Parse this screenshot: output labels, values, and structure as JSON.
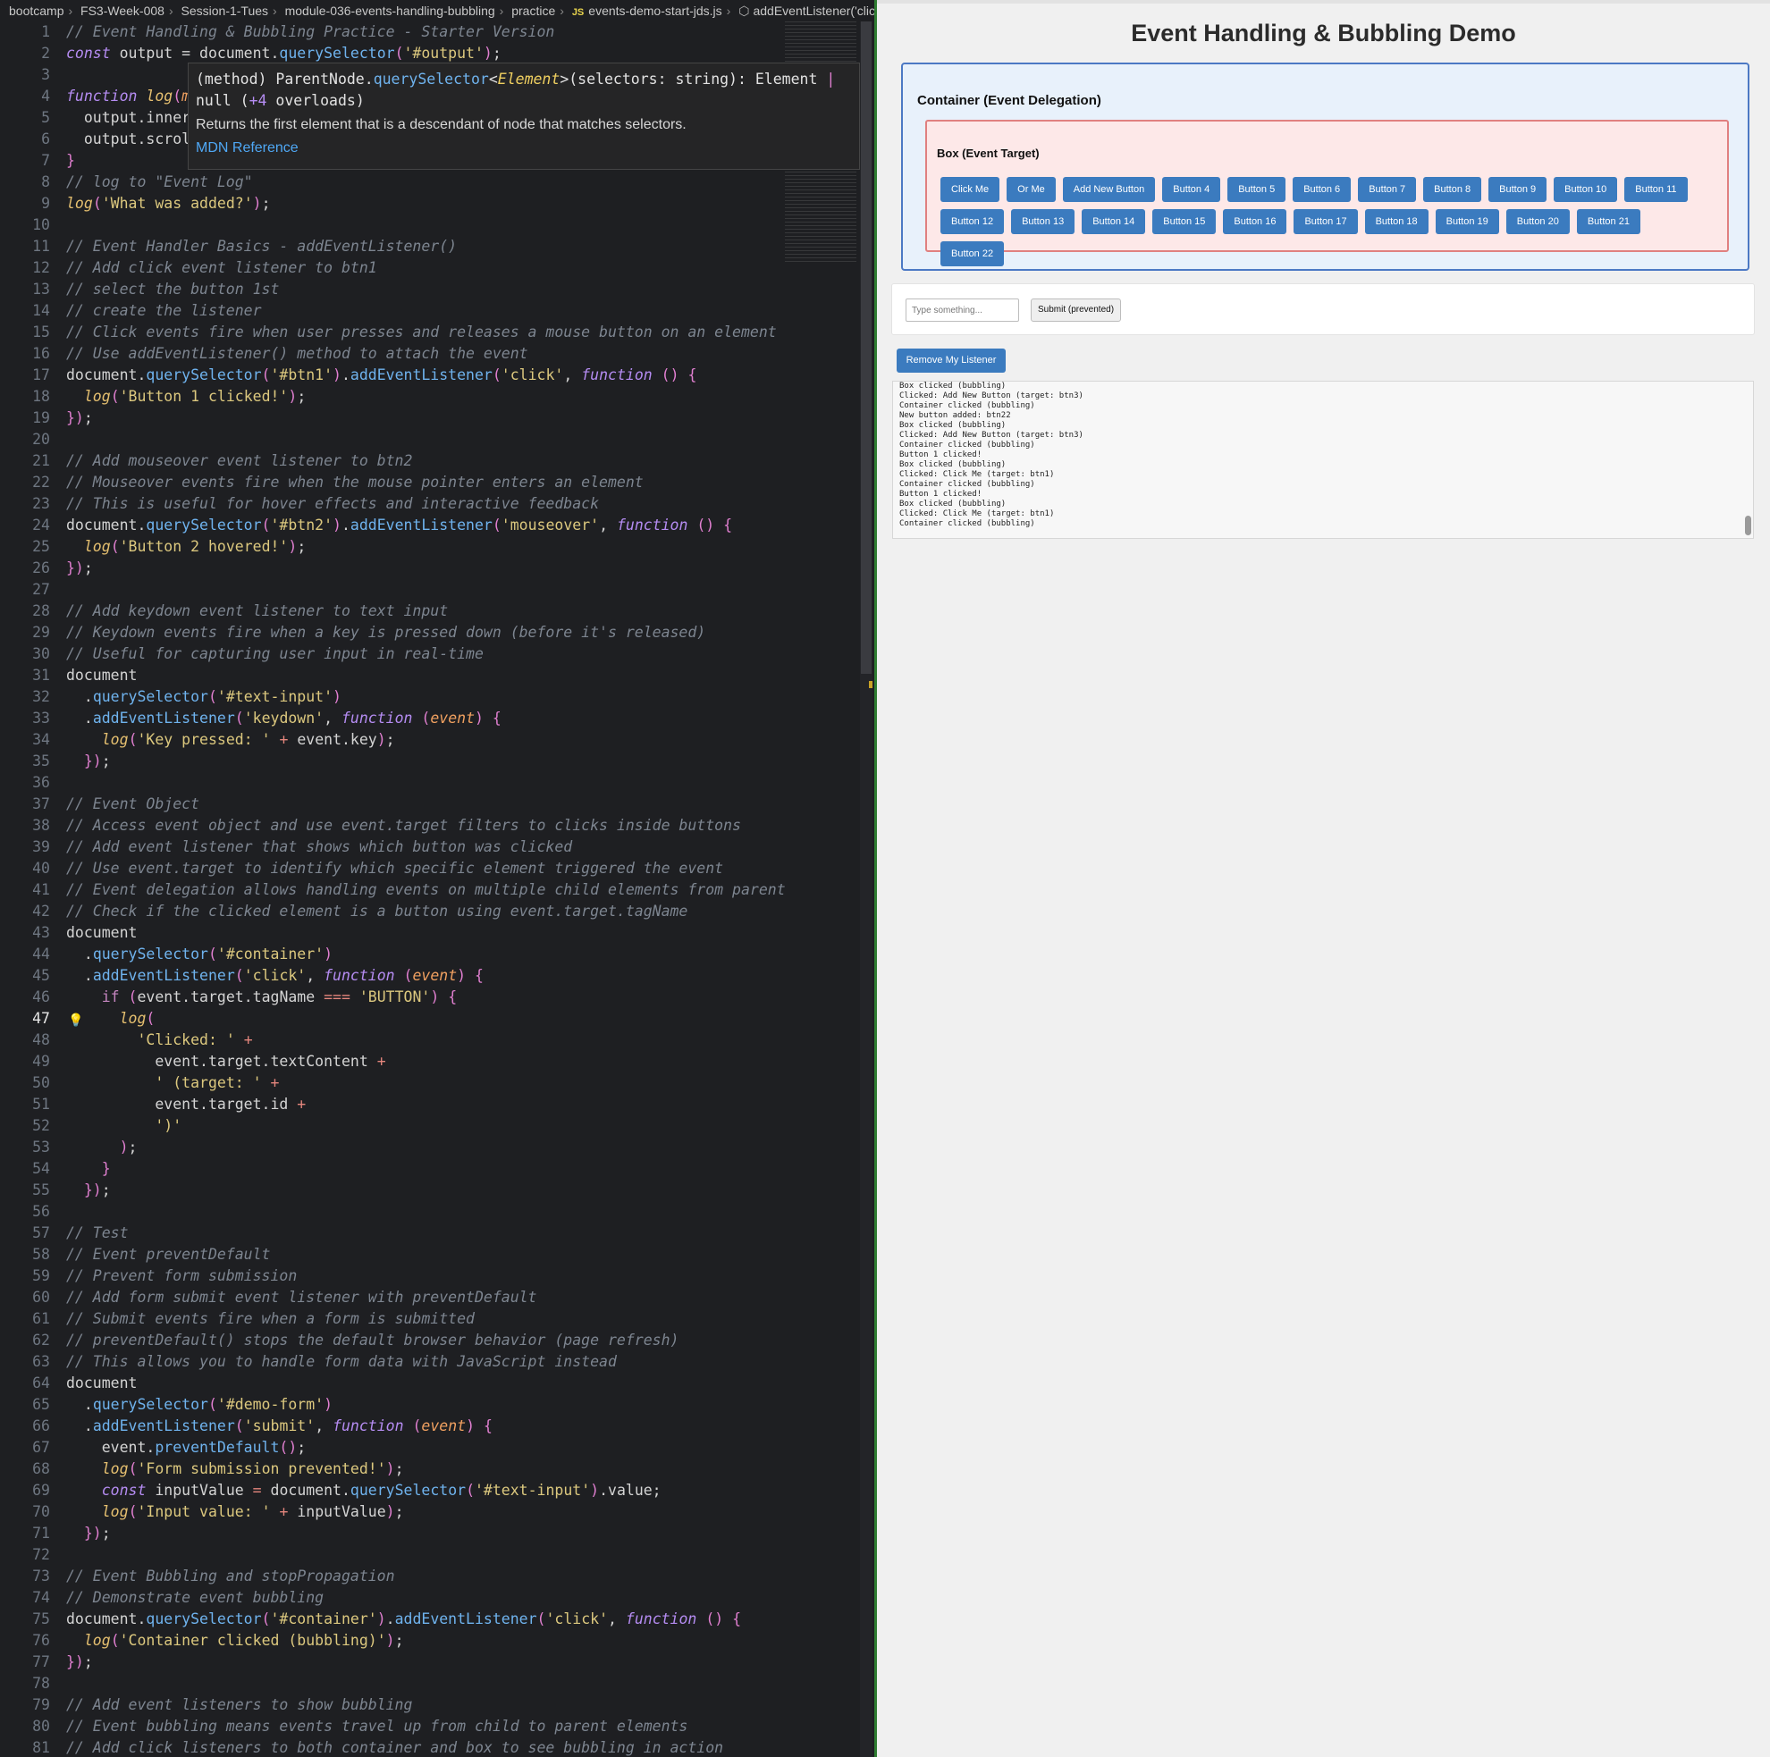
{
  "breadcrumb": {
    "items": [
      "bootcamp",
      "FS3-Week-008",
      "Session-1-Tues",
      "module-036-events-handling-bubbling",
      "practice",
      "events-demo-start-jds.js",
      "addEventListener('click"
    ],
    "js_badge": "JS"
  },
  "editor": {
    "active_line": 47,
    "lightbulb_line": 47,
    "start_line": 1,
    "lines": [
      [
        [
          "c",
          "// Event Handling & Bubbling Practice - Starter Version"
        ]
      ],
      [
        [
          "k",
          "const"
        ],
        [
          "",
          " output = document."
        ],
        [
          "f",
          "querySelector"
        ],
        [
          "p",
          "("
        ],
        [
          "s",
          "'#output'"
        ],
        [
          "p",
          ")"
        ],
        [
          "",
          ";"
        ]
      ],
      [],
      [
        [
          "k",
          "function"
        ],
        [
          "",
          " "
        ],
        [
          "fn",
          "log"
        ],
        [
          "p",
          "("
        ],
        [
          "pa",
          "m"
        ]
      ],
      [
        [
          "",
          "  output.inner"
        ]
      ],
      [
        [
          "",
          "  output.scrol"
        ]
      ],
      [
        [
          "p",
          "}"
        ]
      ],
      [
        [
          "c",
          "// log to \"Event Log\""
        ]
      ],
      [
        [
          "fn",
          "log"
        ],
        [
          "p",
          "("
        ],
        [
          "s",
          "'What was added?'"
        ],
        [
          "p",
          ")"
        ],
        [
          "",
          ";"
        ]
      ],
      [],
      [
        [
          "c",
          "// Event Handler Basics - addEventListener()"
        ]
      ],
      [
        [
          "c",
          "// Add click event listener to btn1"
        ]
      ],
      [
        [
          "c",
          "// select the button 1st"
        ]
      ],
      [
        [
          "c",
          "// create the listener"
        ]
      ],
      [
        [
          "c",
          "// Click events fire when user presses and releases a mouse button on an element"
        ]
      ],
      [
        [
          "c",
          "// Use addEventListener() method to attach the event"
        ]
      ],
      [
        [
          "",
          "document."
        ],
        [
          "f",
          "querySelector"
        ],
        [
          "p",
          "("
        ],
        [
          "s",
          "'#btn1'"
        ],
        [
          "p",
          ")"
        ],
        [
          "",
          "."
        ],
        [
          "f",
          "addEventListener"
        ],
        [
          "p",
          "("
        ],
        [
          "s",
          "'click'"
        ],
        [
          "",
          ", "
        ],
        [
          "k",
          "function"
        ],
        [
          "",
          " "
        ],
        [
          "p",
          "() {"
        ]
      ],
      [
        [
          "",
          "  "
        ],
        [
          "fn",
          "log"
        ],
        [
          "p",
          "("
        ],
        [
          "s",
          "'Button 1 clicked!'"
        ],
        [
          "p",
          ")"
        ],
        [
          "",
          ";"
        ]
      ],
      [
        [
          "p",
          "})"
        ],
        [
          "",
          ";"
        ]
      ],
      [],
      [
        [
          "c",
          "// Add mouseover event listener to btn2"
        ]
      ],
      [
        [
          "c",
          "// Mouseover events fire when the mouse pointer enters an element"
        ]
      ],
      [
        [
          "c",
          "// This is useful for hover effects and interactive feedback"
        ]
      ],
      [
        [
          "",
          "document."
        ],
        [
          "f",
          "querySelector"
        ],
        [
          "p",
          "("
        ],
        [
          "s",
          "'#btn2'"
        ],
        [
          "p",
          ")"
        ],
        [
          "",
          "."
        ],
        [
          "f",
          "addEventListener"
        ],
        [
          "p",
          "("
        ],
        [
          "s",
          "'mouseover'"
        ],
        [
          "",
          ", "
        ],
        [
          "k",
          "function"
        ],
        [
          "",
          " "
        ],
        [
          "p",
          "() {"
        ]
      ],
      [
        [
          "",
          "  "
        ],
        [
          "fn",
          "log"
        ],
        [
          "p",
          "("
        ],
        [
          "s",
          "'Button 2 hovered!'"
        ],
        [
          "p",
          ")"
        ],
        [
          "",
          ";"
        ]
      ],
      [
        [
          "p",
          "})"
        ],
        [
          "",
          ";"
        ]
      ],
      [],
      [
        [
          "c",
          "// Add keydown event listener to text input"
        ]
      ],
      [
        [
          "c",
          "// Keydown events fire when a key is pressed down (before it's released)"
        ]
      ],
      [
        [
          "c",
          "// Useful for capturing user input in real-time"
        ]
      ],
      [
        [
          "",
          "document"
        ]
      ],
      [
        [
          "",
          "  ."
        ],
        [
          "f",
          "querySelector"
        ],
        [
          "p",
          "("
        ],
        [
          "s",
          "'#text-input'"
        ],
        [
          "p",
          ")"
        ]
      ],
      [
        [
          "",
          "  ."
        ],
        [
          "f",
          "addEventListener"
        ],
        [
          "p",
          "("
        ],
        [
          "s",
          "'keydown'"
        ],
        [
          "",
          ", "
        ],
        [
          "k",
          "function"
        ],
        [
          "",
          " "
        ],
        [
          "p",
          "("
        ],
        [
          "pa",
          "event"
        ],
        [
          "p",
          ") {"
        ]
      ],
      [
        [
          "",
          "    "
        ],
        [
          "fn",
          "log"
        ],
        [
          "p",
          "("
        ],
        [
          "s",
          "'Key pressed: '"
        ],
        [
          "op",
          " + "
        ],
        [
          "",
          "event.key"
        ],
        [
          "p",
          ")"
        ],
        [
          "",
          ";"
        ]
      ],
      [
        [
          "",
          "  "
        ],
        [
          "p",
          "})"
        ],
        [
          "",
          ";"
        ]
      ],
      [],
      [
        [
          "c",
          "// Event Object"
        ]
      ],
      [
        [
          "c",
          "// Access event object and use event.target filters to clicks inside buttons"
        ]
      ],
      [
        [
          "c",
          "// Add event listener that shows which button was clicked"
        ]
      ],
      [
        [
          "c",
          "// Use event.target to identify which specific element triggered the event"
        ]
      ],
      [
        [
          "c",
          "// Event delegation allows handling events on multiple child elements from parent"
        ]
      ],
      [
        [
          "c",
          "// Check if the clicked element is a button using event.target.tagName"
        ]
      ],
      [
        [
          "",
          "document"
        ]
      ],
      [
        [
          "",
          "  ."
        ],
        [
          "f",
          "querySelector"
        ],
        [
          "p",
          "("
        ],
        [
          "s",
          "'#container'"
        ],
        [
          "p",
          ")"
        ]
      ],
      [
        [
          "",
          "  ."
        ],
        [
          "f",
          "addEventListener"
        ],
        [
          "p",
          "("
        ],
        [
          "s",
          "'click'"
        ],
        [
          "",
          ", "
        ],
        [
          "k",
          "function"
        ],
        [
          "",
          " "
        ],
        [
          "p",
          "("
        ],
        [
          "pa",
          "event"
        ],
        [
          "p",
          ") {"
        ]
      ],
      [
        [
          "",
          "    "
        ],
        [
          "kw",
          "if"
        ],
        [
          "",
          ""
        ],
        [
          "p",
          " ("
        ],
        [
          "",
          "event.target.tagName "
        ],
        [
          "op",
          "==="
        ],
        [
          "",
          " "
        ],
        [
          "s",
          "'BUTTON'"
        ],
        [
          "p",
          ") {"
        ]
      ],
      [
        [
          "",
          "      "
        ],
        [
          "fn",
          "log"
        ],
        [
          "p",
          "("
        ]
      ],
      [
        [
          "",
          "        "
        ],
        [
          "s",
          "'Clicked: '"
        ],
        [
          "op",
          " +"
        ]
      ],
      [
        [
          "",
          "          event.target.textContent"
        ],
        [
          "op",
          " +"
        ]
      ],
      [
        [
          "",
          "          "
        ],
        [
          "s",
          "' (target: '"
        ],
        [
          "op",
          " +"
        ]
      ],
      [
        [
          "",
          "          event.target.id"
        ],
        [
          "op",
          " +"
        ]
      ],
      [
        [
          "",
          "          "
        ],
        [
          "s",
          "')'"
        ]
      ],
      [
        [
          "",
          "      "
        ],
        [
          "p",
          ")"
        ],
        [
          "",
          ";"
        ]
      ],
      [
        [
          "",
          "    "
        ],
        [
          "p",
          "}"
        ]
      ],
      [
        [
          "",
          "  "
        ],
        [
          "p",
          "})"
        ],
        [
          "",
          ";"
        ]
      ],
      [],
      [
        [
          "c",
          "// Test"
        ]
      ],
      [
        [
          "c",
          "// Event preventDefault"
        ]
      ],
      [
        [
          "c",
          "// Prevent form submission"
        ]
      ],
      [
        [
          "c",
          "// Add form submit event listener with preventDefault"
        ]
      ],
      [
        [
          "c",
          "// Submit events fire when a form is submitted"
        ]
      ],
      [
        [
          "c",
          "// preventDefault() stops the default browser behavior (page refresh)"
        ]
      ],
      [
        [
          "c",
          "// This allows you to handle form data with JavaScript instead"
        ]
      ],
      [
        [
          "",
          "document"
        ]
      ],
      [
        [
          "",
          "  ."
        ],
        [
          "f",
          "querySelector"
        ],
        [
          "p",
          "("
        ],
        [
          "s",
          "'#demo-form'"
        ],
        [
          "p",
          ")"
        ]
      ],
      [
        [
          "",
          "  ."
        ],
        [
          "f",
          "addEventListener"
        ],
        [
          "p",
          "("
        ],
        [
          "s",
          "'submit'"
        ],
        [
          "",
          ", "
        ],
        [
          "k",
          "function"
        ],
        [
          "",
          " "
        ],
        [
          "p",
          "("
        ],
        [
          "pa",
          "event"
        ],
        [
          "p",
          ") {"
        ]
      ],
      [
        [
          "",
          "    event."
        ],
        [
          "f",
          "preventDefault"
        ],
        [
          "p",
          "()"
        ],
        [
          "",
          ";"
        ]
      ],
      [
        [
          "",
          "    "
        ],
        [
          "fn",
          "log"
        ],
        [
          "p",
          "("
        ],
        [
          "s",
          "'Form submission prevented!'"
        ],
        [
          "p",
          ")"
        ],
        [
          "",
          ";"
        ]
      ],
      [
        [
          "",
          "    "
        ],
        [
          "k",
          "const"
        ],
        [
          "",
          " inputValue "
        ],
        [
          "op",
          "="
        ],
        [
          "",
          " document."
        ],
        [
          "f",
          "querySelector"
        ],
        [
          "p",
          "("
        ],
        [
          "s",
          "'#text-input'"
        ],
        [
          "p",
          ")"
        ],
        [
          "",
          ".value;"
        ]
      ],
      [
        [
          "",
          "    "
        ],
        [
          "fn",
          "log"
        ],
        [
          "p",
          "("
        ],
        [
          "s",
          "'Input value: '"
        ],
        [
          "op",
          " + "
        ],
        [
          "",
          "inputValue"
        ],
        [
          "p",
          ")"
        ],
        [
          "",
          ";"
        ]
      ],
      [
        [
          "",
          "  "
        ],
        [
          "p",
          "})"
        ],
        [
          "",
          ";"
        ]
      ],
      [],
      [
        [
          "c",
          "// Event Bubbling and stopPropagation"
        ]
      ],
      [
        [
          "c",
          "// Demonstrate event bubbling"
        ]
      ],
      [
        [
          "",
          "document."
        ],
        [
          "f",
          "querySelector"
        ],
        [
          "p",
          "("
        ],
        [
          "s",
          "'#container'"
        ],
        [
          "p",
          ")"
        ],
        [
          "",
          "."
        ],
        [
          "f",
          "addEventListener"
        ],
        [
          "p",
          "("
        ],
        [
          "s",
          "'click'"
        ],
        [
          "",
          ", "
        ],
        [
          "k",
          "function"
        ],
        [
          "",
          " "
        ],
        [
          "p",
          "() {"
        ]
      ],
      [
        [
          "",
          "  "
        ],
        [
          "fn",
          "log"
        ],
        [
          "p",
          "("
        ],
        [
          "s",
          "'Container clicked (bubbling)'"
        ],
        [
          "p",
          ")"
        ],
        [
          "",
          ";"
        ]
      ],
      [
        [
          "p",
          "})"
        ],
        [
          "",
          ";"
        ]
      ],
      [],
      [
        [
          "c",
          "// Add event listeners to show bubbling"
        ]
      ],
      [
        [
          "c",
          "// Event bubbling means events travel up from child to parent elements"
        ]
      ],
      [
        [
          "c",
          "// Add click listeners to both container and box to see bubbling in action"
        ]
      ]
    ]
  },
  "tooltip": {
    "signature_prefix": "(method) ParentNode.",
    "method": "querySelector",
    "type_open": "<",
    "type_param": "Element",
    "type_close": ">(selectors: string): Element ",
    "pipe": "|",
    "null_text": "null (",
    "overloads_count": "+4",
    "overloads_text": " overloads)",
    "description": "Returns the first element that is a descendant of node that matches selectors.",
    "link": "MDN Reference"
  },
  "browser": {
    "title": "Event Handling & Bubbling Demo",
    "container_label": "Container (Event Delegation)",
    "box_label": "Box (Event Target)",
    "buttons_row1": [
      "Click Me",
      "Or Me",
      "Add New Button",
      "Button 4",
      "Button 5",
      "Button 6",
      "Button 7",
      "Button 8",
      "Button 9",
      "Button 10",
      "Button 11"
    ],
    "buttons_row2": [
      "Button 12",
      "Button 13",
      "Button 14",
      "Button 15",
      "Button 16",
      "Button 17",
      "Button 18",
      "Button 19",
      "Button 20",
      "Button 21",
      "Button 22"
    ],
    "input_placeholder": "Type something...",
    "submit_label": "Submit (prevented)",
    "remove_label": "Remove My Listener",
    "log_lines": [
      "Box clicked (bubbling)",
      "Clicked: Add New Button (target: btn3)",
      "Container clicked (bubbling)",
      "New button added: btn22",
      "Box clicked (bubbling)",
      "Clicked: Add New Button (target: btn3)",
      "Container clicked (bubbling)",
      "Button 1 clicked!",
      "Box clicked (bubbling)",
      "Clicked: Click Me (target: btn1)",
      "Container clicked (bubbling)",
      "Button 1 clicked!",
      "Box clicked (bubbling)",
      "Clicked: Click Me (target: btn1)",
      "Container clicked (bubbling)"
    ]
  },
  "colors": {
    "editor_bg": "#1e1f22",
    "comment": "#7d8590",
    "string": "#dcc87e",
    "method": "#6fb3ee",
    "keyword": "#b58cf2",
    "button_blue": "#3b7bbf",
    "container_border": "#4c79c4",
    "box_border": "#e08080"
  },
  "icons": {
    "lightbulb": "lightbulb-icon",
    "symbol": "symbol-method-icon"
  }
}
